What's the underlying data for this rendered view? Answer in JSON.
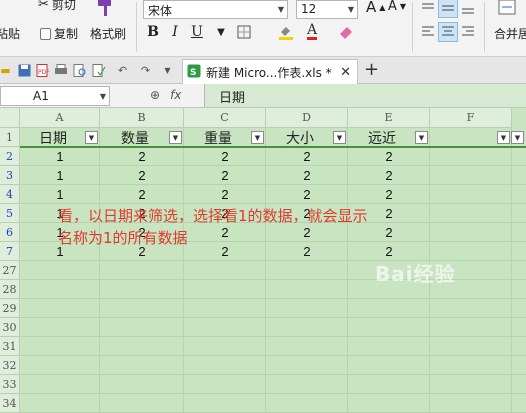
{
  "ribbon": {
    "cut_label": "剪切",
    "paste_label": "粘贴",
    "copy_label": "复制",
    "format_painter_label": "格式刷",
    "font_name": "宋体",
    "font_size": "12",
    "bold": "B",
    "italic": "I",
    "underline": "U",
    "merge_label": "合并居中",
    "grow_font": "A",
    "shrink_font": "A",
    "font_color_letter": "A"
  },
  "tabbar": {
    "doc_tab_label": "新建 Micro...作表.xls *",
    "doc_close": "✕",
    "add_tab": "+"
  },
  "formula_bar": {
    "name_box": "A1",
    "fx_symbol": "fx",
    "zoom_symbol": "⊕",
    "value": "日期"
  },
  "columns": [
    "A",
    "B",
    "C",
    "D",
    "E",
    "F"
  ],
  "rows": [
    "1",
    "2",
    "3",
    "4",
    "5",
    "6",
    "7",
    "27",
    "28",
    "29",
    "30",
    "31",
    "32",
    "33",
    "34"
  ],
  "header_cells": [
    "日期",
    "数量",
    "重量",
    "大小",
    "远近"
  ],
  "data_rows": [
    [
      "1",
      "2",
      "2",
      "2",
      "2"
    ],
    [
      "1",
      "2",
      "2",
      "2",
      "2"
    ],
    [
      "1",
      "2",
      "2",
      "2",
      "2"
    ],
    [
      "1",
      "2",
      "2",
      "2",
      "2"
    ],
    [
      "1",
      "2",
      "2",
      "2",
      "2"
    ],
    [
      "1",
      "2",
      "2",
      "2",
      "2"
    ]
  ],
  "note": {
    "line1": "看，以日期来筛选，选择看1的数据，就会显示",
    "line2": "名称为1的所有数据"
  },
  "watermark": "Bai经验",
  "colors": {
    "grid_bg": "#c9e4c0",
    "note_red": "#e03a2f",
    "accent_green": "#4a8f3e"
  }
}
